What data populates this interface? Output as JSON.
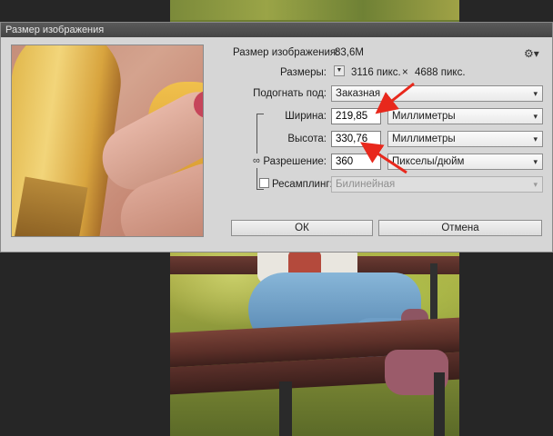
{
  "dialog": {
    "title": "Размер изображения",
    "image_size_label": "Размер изображения:",
    "image_size_value": "83,6M",
    "dimensions_label": "Размеры:",
    "dimensions_width": "3116 пикс.",
    "dimensions_sep": "×",
    "dimensions_height": "4688 пикс.",
    "fit_label": "Подогнать под:",
    "fit_value": "Заказная",
    "width_label": "Ширина:",
    "width_value": "219,85",
    "width_unit": "Миллиметры",
    "height_label": "Высота:",
    "height_value": "330,76",
    "height_unit": "Миллиметры",
    "resolution_label": "Разрешение:",
    "resolution_value": "360",
    "resolution_unit": "Пикселы/дюйм",
    "resample_label": "Ресамплинг:",
    "resample_checked": false,
    "resample_value": "Билинейная",
    "ok_label": "ОК",
    "cancel_label": "Отмена"
  },
  "icons": {
    "gear": "gear-icon",
    "dropdown": "chevron-updown-icon",
    "link": "chain-link-icon",
    "dimensions_toggle": "triangle-down-icon"
  },
  "colors": {
    "dialog_bg": "#d6d6d6",
    "titlebar": "#4d4d4d",
    "annotation_arrow": "#e8281c",
    "app_bg": "#262626"
  }
}
